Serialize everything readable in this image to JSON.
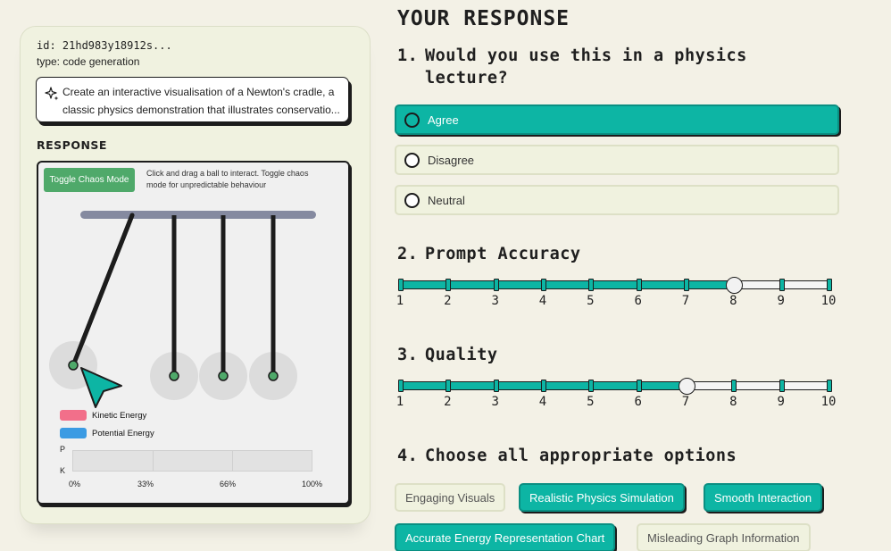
{
  "meta": {
    "id": "id: 21hd983y18912s...",
    "type": "type: code generation"
  },
  "prompt": {
    "line1": "Create an interactive visualisation of a Newton's cradle, a",
    "line2": "classic physics demonstration that illustrates conservatio..."
  },
  "response": {
    "heading": "RESPONSE",
    "chaos_button": "Toggle Chaos Mode",
    "instructions": "Click and drag a ball to interact. Toggle chaos mode for unpredictable behaviour",
    "legend": {
      "kinetic": "Kinetic Energy",
      "potential": "Potential Energy",
      "kinetic_color": "#f26f8a",
      "potential_color": "#3b9be3"
    },
    "bar_labels": {
      "p": "P",
      "k": "K"
    },
    "axis": [
      "0%",
      "33%",
      "66%",
      "100%"
    ]
  },
  "panel": {
    "title": "YOUR RESPONSE",
    "q1": {
      "num": "1.",
      "line1": "Would you use this in a physics",
      "line2": "lecture?",
      "options": [
        "Agree",
        "Disagree",
        "Neutral"
      ],
      "selected": "Agree"
    },
    "q2": {
      "num": "2.",
      "title": "Prompt Accuracy",
      "value": 8,
      "min": 1,
      "max": 10
    },
    "q3": {
      "num": "3.",
      "title": "Quality",
      "value": 7,
      "min": 1,
      "max": 10
    },
    "q4": {
      "num": "4.",
      "title": "Choose all appropriate options",
      "chips": [
        {
          "label": "Engaging Visuals",
          "on": false
        },
        {
          "label": "Realistic Physics Simulation",
          "on": true
        },
        {
          "label": "Smooth Interaction",
          "on": true
        },
        {
          "label": "Accurate Energy Representation Chart",
          "on": true
        },
        {
          "label": "Misleading Graph Information",
          "on": false
        }
      ]
    }
  },
  "colors": {
    "accent": "#0db5a4",
    "chaos": "#4fa96a",
    "ball_dot": "#4fa96a"
  }
}
